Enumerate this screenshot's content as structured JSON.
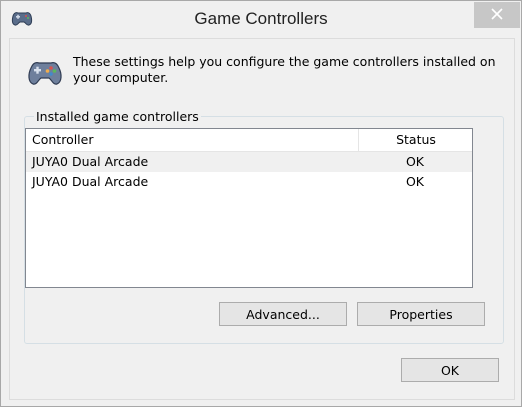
{
  "window": {
    "title": "Game Controllers",
    "title_icon": "gamepad-icon",
    "close_icon": "close-icon"
  },
  "intro": {
    "icon": "gamepad-icon",
    "text": "These settings help you configure the game controllers installed on your computer."
  },
  "group": {
    "label": "Installed game controllers"
  },
  "list": {
    "columns": [
      "Controller",
      "Status"
    ],
    "rows": [
      {
        "controller": "JUYA0 Dual Arcade",
        "status": "OK"
      },
      {
        "controller": "JUYA0 Dual Arcade",
        "status": "OK"
      }
    ]
  },
  "buttons": {
    "advanced": "Advanced...",
    "properties": "Properties",
    "ok": "OK"
  },
  "colors": {
    "window_bg": "#f0f0f0",
    "list_bg": "#ffffff",
    "selected_row_bg": "#f0f0f0",
    "close_button_bg": "#c7c7c7"
  }
}
